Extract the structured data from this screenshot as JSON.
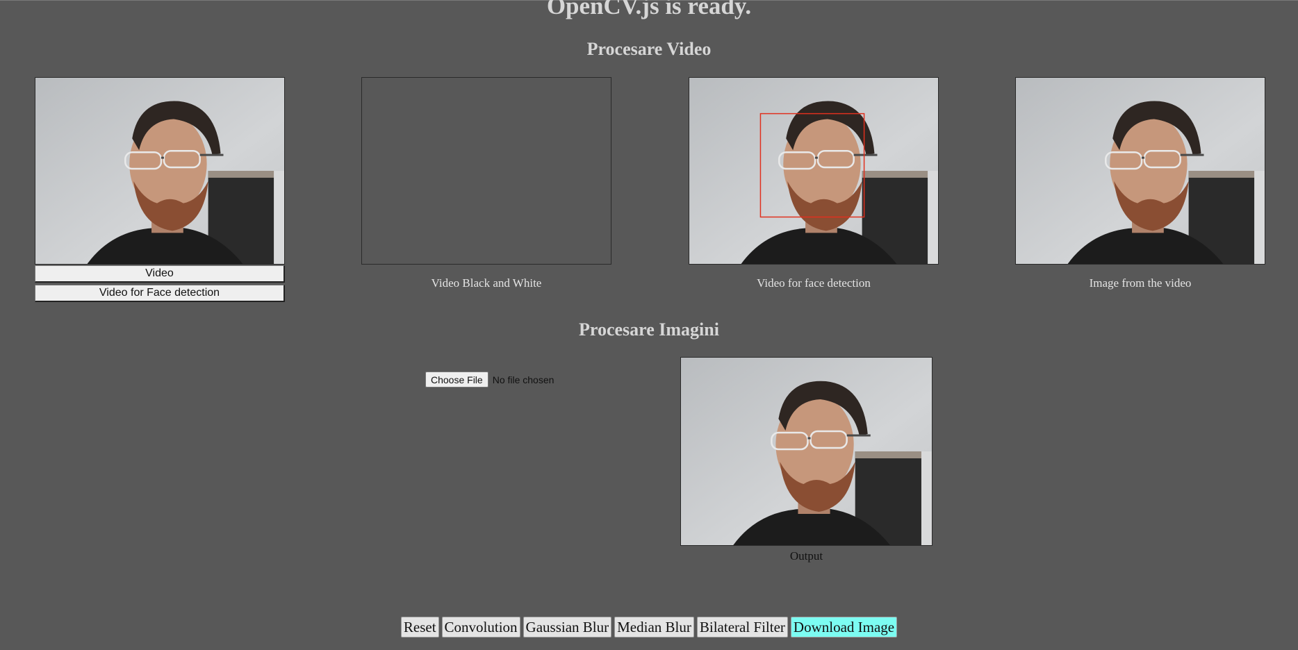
{
  "page": {
    "title": "OpenCV.js is ready.",
    "video_section_title": "Procesare Video",
    "image_section_title": "Procesare Imagini"
  },
  "video_section": {
    "buttons": {
      "video": "Video",
      "face_detection": "Video for Face detection"
    },
    "captions": {
      "black_white": "Video Black and White",
      "face_detection": "Video for face detection",
      "image_from_video": "Image from the video"
    }
  },
  "image_section": {
    "choose_file_label": "Choose File",
    "file_status": "No file chosen",
    "output_caption": "Output"
  },
  "toolbar": {
    "reset": "Reset",
    "convolution": "Convolution",
    "gaussian_blur": "Gaussian Blur",
    "median_blur": "Median Blur",
    "bilateral_filter": "Bilateral Filter",
    "download_image": "Download Image"
  },
  "colors": {
    "background": "#585858",
    "download_accent": "#7cfcf2",
    "face_box": "#e0301e"
  }
}
